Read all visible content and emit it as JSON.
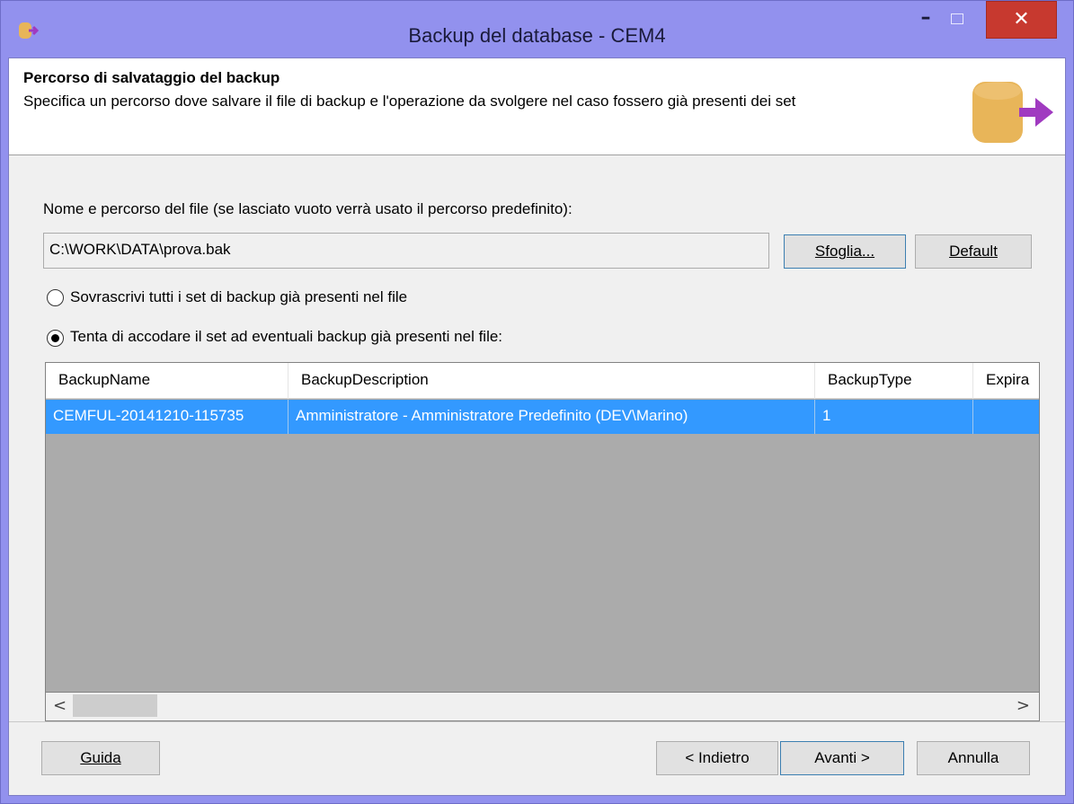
{
  "window": {
    "title": "Backup del database - CEM4",
    "minimize_glyph": "–",
    "maximize_glyph": "",
    "close_glyph": "✕",
    "icon_name": "database-export-icon"
  },
  "header": {
    "title": "Percorso di salvataggio del backup",
    "description": "Specifica un percorso dove salvare il file di backup e l'operazione da svolgere nel caso fossero già presenti dei set",
    "icon_name": "database-arrow-icon"
  },
  "file": {
    "label": "Nome e percorso del file (se lasciato vuoto verrà usato il percorso predefinito):",
    "path_value": "C:\\WORK\\DATA\\prova.bak",
    "browse_button": "Sfoglia...",
    "default_button": "Default"
  },
  "options": {
    "overwrite_label": "Sovrascrivi tutti i set di backup già presenti nel file",
    "overwrite_selected": false,
    "append_label": "Tenta di accodare il set ad eventuali backup già presenti nel file:",
    "append_selected": true
  },
  "grid": {
    "columns": [
      "BackupName",
      "BackupDescription",
      "BackupType",
      "Expira"
    ],
    "rows": [
      {
        "BackupName": "CEMFUL-20141210-115735",
        "BackupDescription": "Amministratore - Amministratore Predefinito (DEV\\Marino)",
        "BackupType": "1",
        "Expira": "",
        "selected": true
      }
    ],
    "scroll_left_glyph": "<",
    "scroll_right_glyph": ">"
  },
  "footer": {
    "help_button": "Guida",
    "back_button": "< Indietro",
    "next_button": "Avanti >",
    "cancel_button": "Annulla"
  },
  "colors": {
    "titlebar": "#9291ee",
    "close_button": "#c7392f",
    "selection": "#3399ff",
    "grid_background": "#ababab"
  }
}
